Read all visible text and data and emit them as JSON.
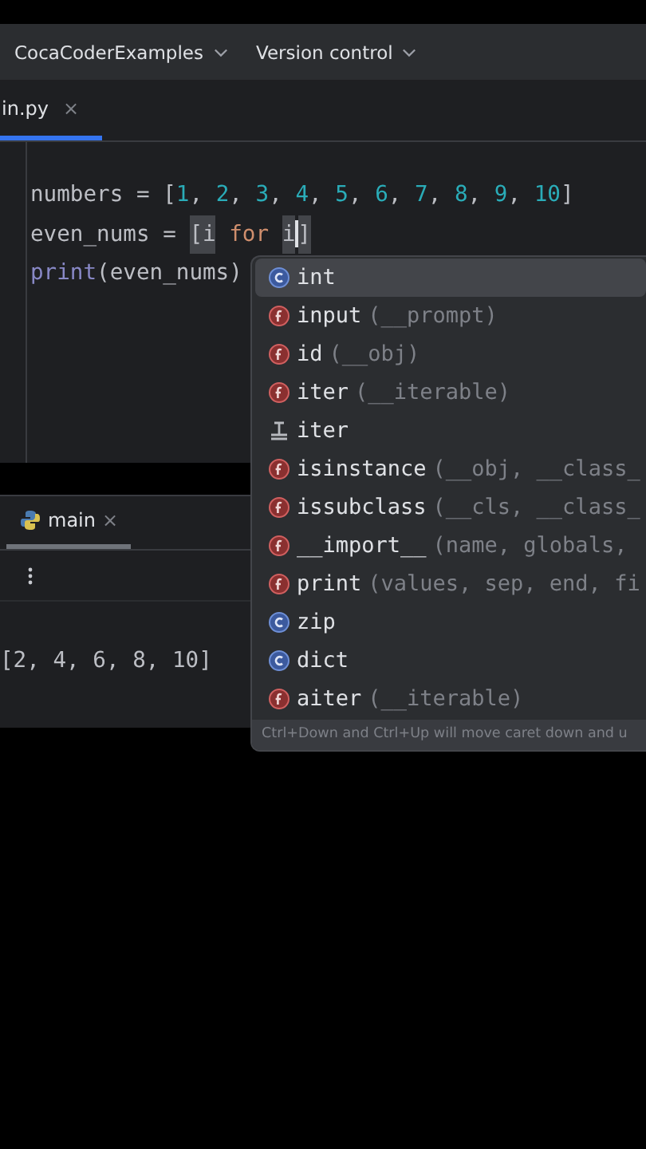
{
  "toolbar": {
    "project": "CocaCoderExamples",
    "vcs": "Version control"
  },
  "editor_tabs": [
    {
      "label": "in.py",
      "close": "×",
      "selected": true
    }
  ],
  "code_lines": [
    {
      "tokens": [
        {
          "text": "numbers = [",
          "kind": "plain"
        },
        {
          "text": "1",
          "kind": "number"
        },
        {
          "text": ", ",
          "kind": "plain"
        },
        {
          "text": "2",
          "kind": "number"
        },
        {
          "text": ", ",
          "kind": "plain"
        },
        {
          "text": "3",
          "kind": "number"
        },
        {
          "text": ", ",
          "kind": "plain"
        },
        {
          "text": "4",
          "kind": "number"
        },
        {
          "text": ", ",
          "kind": "plain"
        },
        {
          "text": "5",
          "kind": "number"
        },
        {
          "text": ", ",
          "kind": "plain"
        },
        {
          "text": "6",
          "kind": "number"
        },
        {
          "text": ", ",
          "kind": "plain"
        },
        {
          "text": "7",
          "kind": "number"
        },
        {
          "text": ", ",
          "kind": "plain"
        },
        {
          "text": "8",
          "kind": "number"
        },
        {
          "text": ", ",
          "kind": "plain"
        },
        {
          "text": "9",
          "kind": "number"
        },
        {
          "text": ", ",
          "kind": "plain"
        },
        {
          "text": "10",
          "kind": "number"
        },
        {
          "text": "]",
          "kind": "plain"
        }
      ]
    },
    {
      "tokens": [
        {
          "text": "even_nums = ",
          "kind": "plain"
        },
        {
          "text": "[i",
          "kind": "bracket"
        },
        {
          "text": " for ",
          "kind": "keyword"
        },
        {
          "text": "i",
          "kind": "bracket",
          "cursor": true
        },
        {
          "text": "]",
          "kind": "bracket"
        }
      ]
    },
    {
      "tokens": [
        {
          "text": "print",
          "kind": "builtin"
        },
        {
          "text": "(even_nums)",
          "kind": "plain"
        }
      ]
    }
  ],
  "run_tabs": [
    {
      "label": "main",
      "close": "×",
      "selected": true
    }
  ],
  "output": "[2, 4, 6, 8, 10]",
  "completion": {
    "items": [
      {
        "kind": "class",
        "name": "int",
        "selected": true
      },
      {
        "kind": "function",
        "name": "input",
        "params": "(__prompt)",
        "selected": false
      },
      {
        "kind": "function",
        "name": "id",
        "params": "(__obj)",
        "selected": false
      },
      {
        "kind": "function",
        "name": "iter",
        "params": "(__iterable)",
        "selected": false
      },
      {
        "kind": "template",
        "name": "iter",
        "selected": false
      },
      {
        "kind": "function",
        "name": "isinstance",
        "params": "(__obj, __class_",
        "selected": false
      },
      {
        "kind": "function",
        "name": "issubclass",
        "params": "(__cls, __class_",
        "selected": false
      },
      {
        "kind": "function",
        "name": "__import__",
        "params": "(name, globals,",
        "selected": false
      },
      {
        "kind": "function",
        "name": "print",
        "params": "(values, sep, end, fi",
        "selected": false
      },
      {
        "kind": "class",
        "name": "zip",
        "selected": false
      },
      {
        "kind": "class",
        "name": "dict",
        "selected": false
      },
      {
        "kind": "function",
        "name": "aiter",
        "params": "(__iterable)",
        "selected": false
      }
    ],
    "hint": "Ctrl+Down and Ctrl+Up will move caret down and u"
  }
}
